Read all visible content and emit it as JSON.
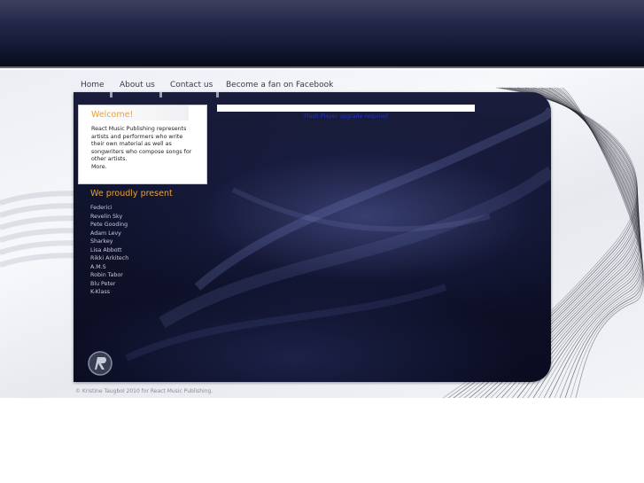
{
  "nav": {
    "items": [
      {
        "label": "Home"
      },
      {
        "label": "About us"
      },
      {
        "label": "Contact us"
      },
      {
        "label": "Become a fan on Facebook"
      }
    ]
  },
  "welcome": {
    "title": "Welcome!",
    "text": "React Music Publishing represents artists and performers who write their own material as well as songwriters who compose songs for other artists.",
    "more_label": "More."
  },
  "roster": {
    "title": "We proudly present",
    "artists": [
      "Federici",
      "Revelin Sky",
      "Pete Gooding",
      "Adam Levy",
      "Sharkey",
      "Lisa Abbott",
      "Rikki Arkitech",
      "A.M.S",
      "Robin Tabor",
      "Blu Peter",
      "K-Klass"
    ]
  },
  "flash": {
    "message": "Flash Player upgrade required"
  },
  "logo": {
    "icon": "react-r-logo-icon"
  },
  "footer": {
    "text": "© Kristine Taugbol 2010 for React Music Publishing."
  },
  "colors": {
    "accent": "#e7a235",
    "panel": "#10132c",
    "banner": "#1b2040",
    "link": "#2233bb"
  }
}
